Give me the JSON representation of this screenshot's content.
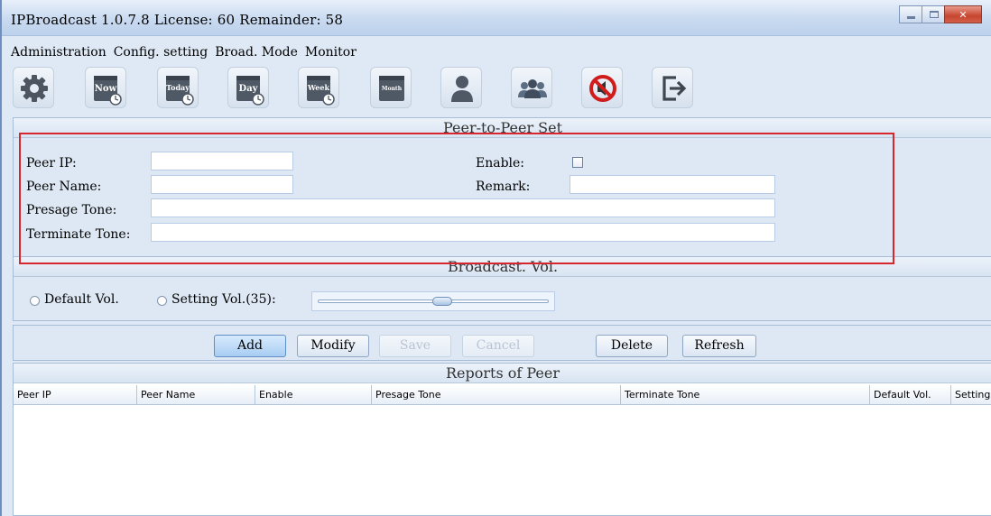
{
  "window": {
    "title": "IPBroadcast 1.0.7.8 License: 60 Remainder: 58"
  },
  "menu": [
    "Administration",
    "Config. setting",
    "Broad. Mode",
    "Monitor"
  ],
  "toolbar": {
    "items": [
      {
        "name": "settings",
        "icon": "gear-icon"
      },
      {
        "name": "now",
        "label": "Now",
        "icon": "calendar-clock-icon"
      },
      {
        "name": "today",
        "label": "Today",
        "icon": "calendar-clock-icon"
      },
      {
        "name": "day",
        "label": "Day",
        "icon": "calendar-clock-icon"
      },
      {
        "name": "week",
        "label": "Week",
        "icon": "calendar-clock-icon"
      },
      {
        "name": "month",
        "label": "Month",
        "icon": "calendar-icon"
      },
      {
        "name": "user",
        "icon": "user-icon"
      },
      {
        "name": "group",
        "icon": "users-icon"
      },
      {
        "name": "mute",
        "icon": "no-sound-icon"
      },
      {
        "name": "exit",
        "icon": "exit-icon"
      }
    ]
  },
  "peer_set": {
    "title": "Peer-to-Peer Set",
    "peer_ip_label": "Peer IP:",
    "peer_ip_value": "",
    "peer_name_label": "Peer Name:",
    "peer_name_value": "",
    "enable_label": "Enable:",
    "enable_checked": false,
    "remark_label": "Remark:",
    "remark_value": "",
    "presage_label": "Presage Tone:",
    "presage_value": "",
    "terminate_label": "Terminate Tone:",
    "terminate_value": ""
  },
  "volume": {
    "title": "Broadcast. Vol.",
    "default_label": "Default Vol.",
    "setting_label": "Setting Vol.(35):",
    "setting_value": 35,
    "slider_fraction": 0.54
  },
  "buttons": {
    "add": "Add",
    "modify": "Modify",
    "save": "Save",
    "cancel": "Cancel",
    "delete": "Delete",
    "refresh": "Refresh"
  },
  "reports": {
    "title": "Reports of Peer",
    "columns": [
      "Peer IP",
      "Peer Name",
      "Enable",
      "Presage Tone",
      "Terminate Tone",
      "Default Vol.",
      "Setting V"
    ],
    "rows": []
  },
  "colors": {
    "highlight_box": "#d8262e",
    "primary_button": "#a8cdf3"
  }
}
